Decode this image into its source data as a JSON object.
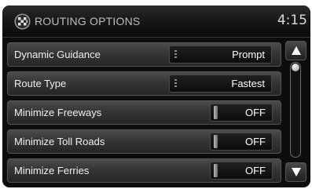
{
  "header": {
    "title": "ROUTING OPTIONS",
    "clock": "4:15",
    "icon": "checkered-flag-icon"
  },
  "rows": [
    {
      "label": "Dynamic Guidance",
      "value": "Prompt",
      "control": "select"
    },
    {
      "label": "Route Type",
      "value": "Fastest",
      "control": "select"
    },
    {
      "label": "Minimize Freeways",
      "value": "OFF",
      "control": "toggle"
    },
    {
      "label": "Minimize Toll Roads",
      "value": "OFF",
      "control": "toggle"
    },
    {
      "label": "Minimize Ferries",
      "value": "OFF",
      "control": "toggle"
    }
  ],
  "scrollbar": {
    "up_icon": "triangle-up-icon",
    "down_icon": "triangle-down-icon",
    "position": 0
  },
  "colors": {
    "screen_background": "#0d0d0d",
    "row_background": "#353535",
    "text": "#ffffff"
  }
}
